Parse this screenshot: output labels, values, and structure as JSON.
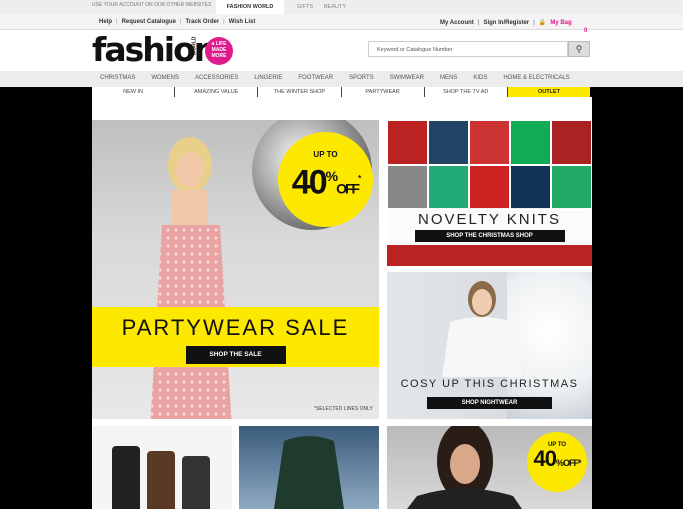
{
  "top_strip": {
    "note": "USE YOUR ACCOUNT ON OUR OTHER WEBSITES",
    "tabs": [
      {
        "label": "FASHION WORLD",
        "active": true
      },
      {
        "label": "GIFTS",
        "active": false
      },
      {
        "label": "BEAUTY",
        "active": false
      }
    ]
  },
  "util": {
    "left": [
      "Help",
      "Request Catalogue",
      "Track Order",
      "Wish List"
    ],
    "right": [
      "My Account",
      "Sign In/Register"
    ],
    "bag_label": "My Bag",
    "bag_count": "0"
  },
  "header": {
    "logo": "fashion",
    "logo_sub": "WORLD",
    "badge": "a LIFE MADE MORE",
    "search_placeholder": "Keyword or Catalogue Number"
  },
  "main_nav": [
    "CHRISTMAS",
    "WOMENS",
    "ACCESSORIES",
    "LINGERIE",
    "FOOTWEAR",
    "SPORTS",
    "SWIMWEAR",
    "MENS",
    "KIDS",
    "HOME & ELECTRICALS"
  ],
  "sub_nav": [
    "NEW IN",
    "AMAZING VALUE",
    "THE WINTER SHOP",
    "PARTYWEAR",
    "SHOP THE TV AD",
    "OUTLET"
  ],
  "hero": {
    "promo_up_to": "UP TO",
    "promo_value": "40",
    "promo_pct": "%",
    "promo_off": "OFF",
    "promo_mark": "*",
    "title": "PARTYWEAR SALE",
    "button": "SHOP THE SALE",
    "footnote": "*SELECTED LINES ONLY"
  },
  "knits": {
    "title": "NOVELTY KNITS",
    "button": "SHOP THE CHRISTMAS SHOP"
  },
  "nightwear": {
    "title": "COSY UP THIS CHRISTMAS",
    "button": "SHOP NIGHTWEAR"
  },
  "coat_promo": {
    "up_to": "UP TO",
    "value": "40",
    "pct": "%",
    "off": "OFF",
    "mark": "*"
  },
  "colors": {
    "accent_pink": "#e0198c",
    "promo_yellow": "#fde800"
  }
}
